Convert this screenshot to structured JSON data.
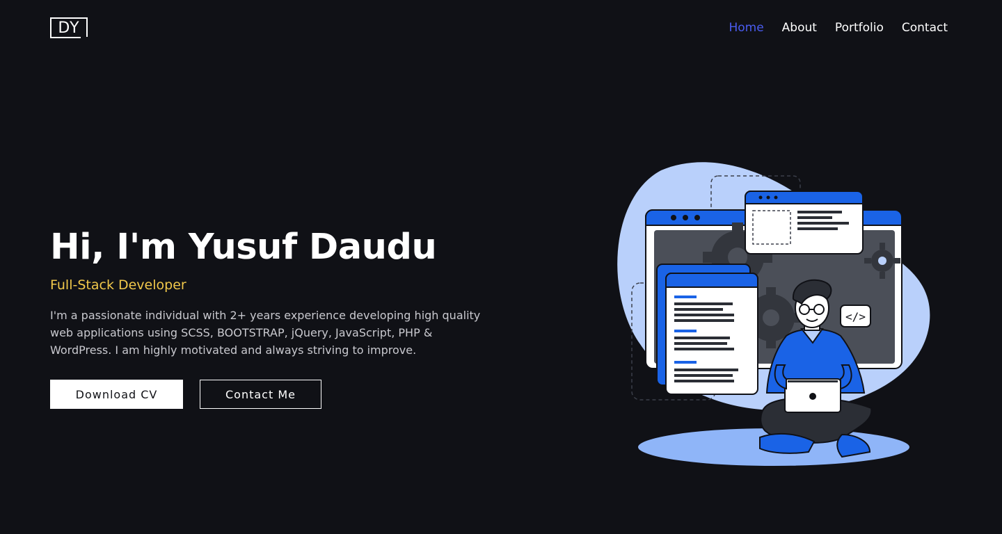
{
  "header": {
    "logo_text": "DY",
    "nav": [
      {
        "label": "Home",
        "active": true
      },
      {
        "label": "About",
        "active": false
      },
      {
        "label": "Portfolio",
        "active": false
      },
      {
        "label": "Contact",
        "active": false
      }
    ]
  },
  "hero": {
    "title": "Hi, I'm Yusuf Daudu",
    "role": "Full-Stack Developer",
    "description": "I'm a passionate individual with 2+ years experience developing high quality web applications using SCSS, BOOTSTRAP, jQuery, JavaScript, PHP & WordPress. I am highly motivated and always striving to improve.",
    "buttons": {
      "download": "Download CV",
      "contact": "Contact Me"
    }
  },
  "illustration": {
    "code_badge": "</>",
    "icons": [
      "developer-illustration",
      "browser-window-icon",
      "gear-icon",
      "laptop-icon",
      "code-tag-icon"
    ]
  },
  "colors": {
    "background": "#101116",
    "accent": "#4a5cf0",
    "role": "#f1c84b",
    "illustration_blue": "#1a63e6",
    "illustration_light": "#b9d0fb"
  }
}
